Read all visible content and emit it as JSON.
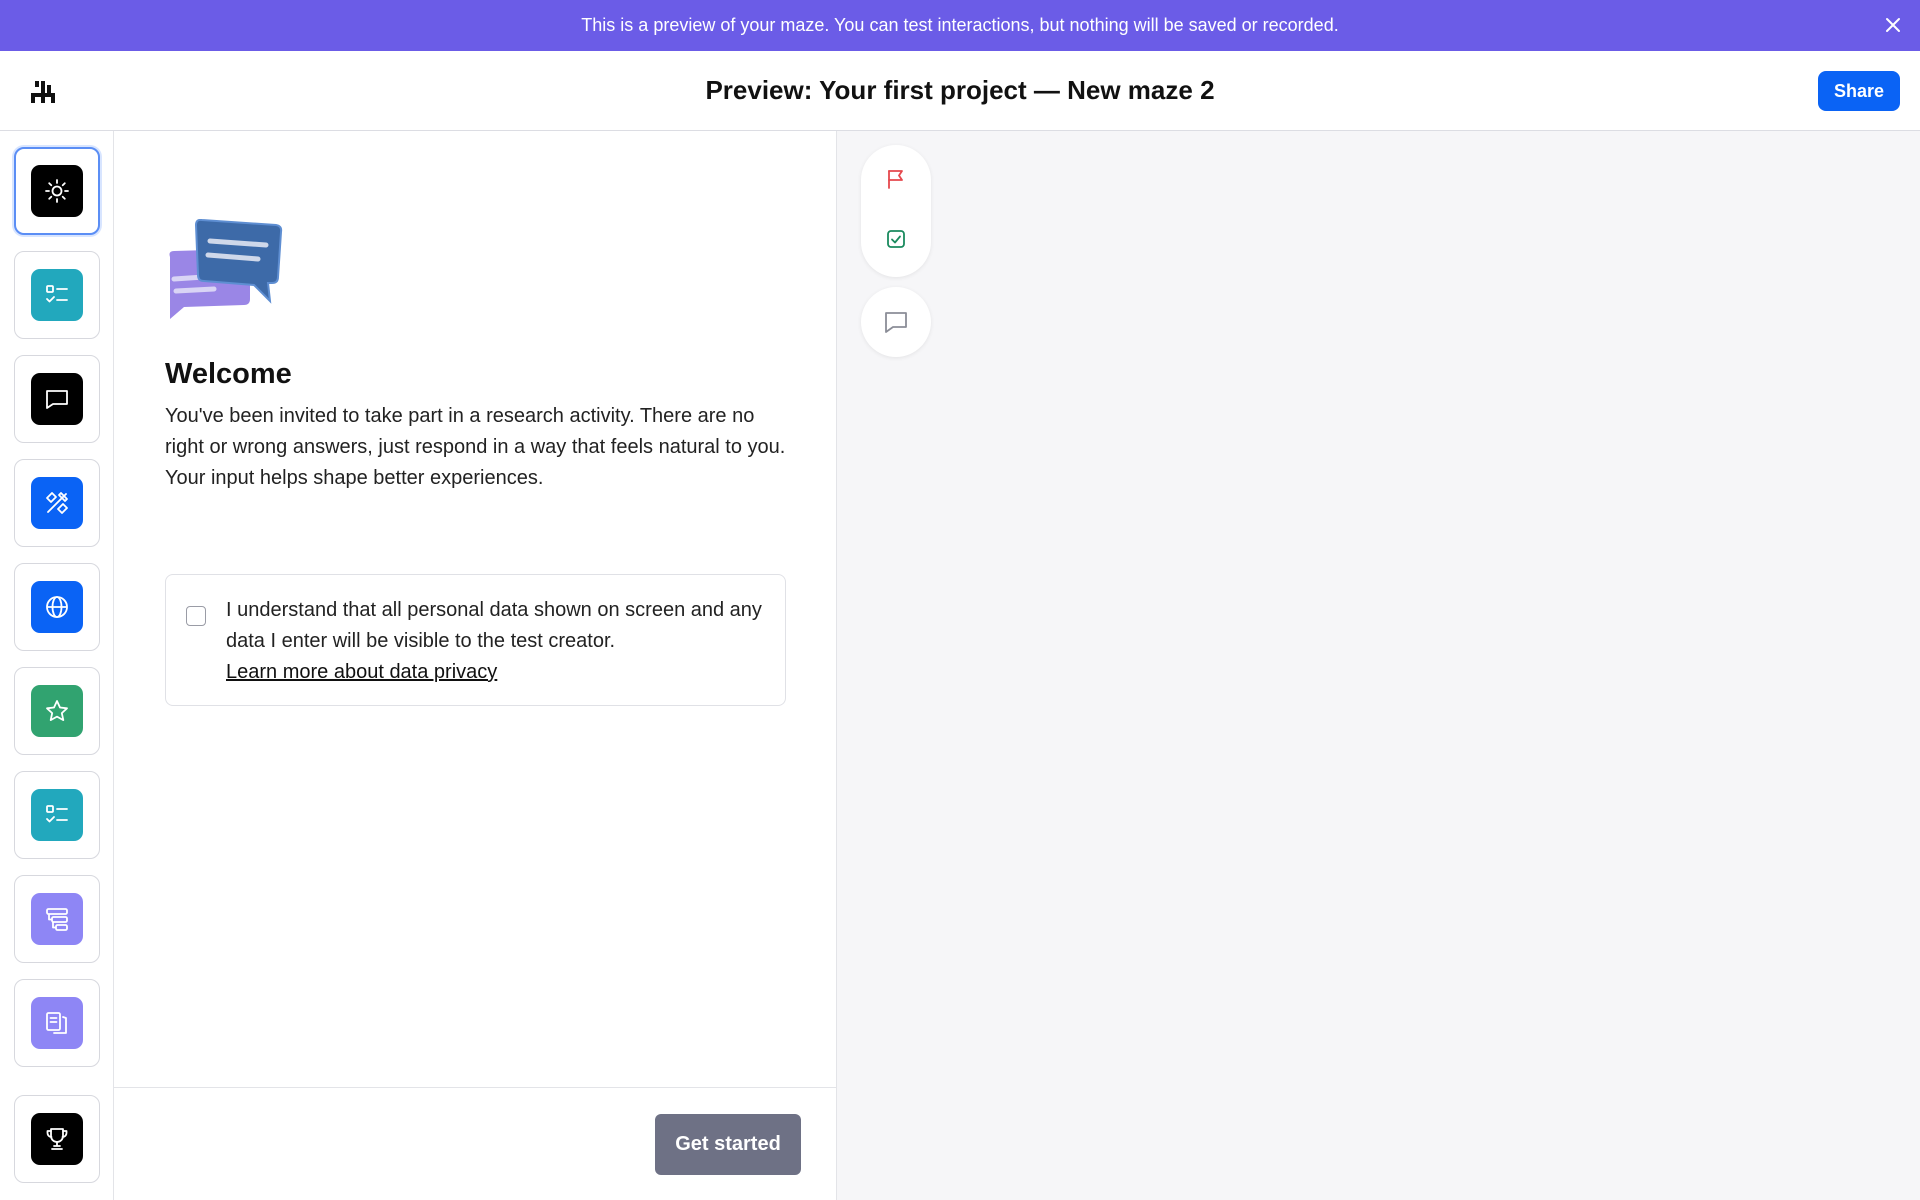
{
  "banner": {
    "message": "This is a preview of your maze. You can test interactions, but nothing will be saved or recorded.",
    "close_icon": "close-icon"
  },
  "header": {
    "logo_icon": "maze-logo-icon",
    "title": "Preview: Your first project — New maze 2",
    "share_label": "Share"
  },
  "sidebar": {
    "steps": [
      {
        "name": "welcome",
        "icon": "sun-icon",
        "color": "#000000",
        "active": true
      },
      {
        "name": "checklist",
        "icon": "checklist-icon",
        "color": "#22a8bd"
      },
      {
        "name": "message",
        "icon": "message-icon",
        "color": "#000000"
      },
      {
        "name": "design-test",
        "icon": "pencil-ruler-icon",
        "color": "#0a63f5"
      },
      {
        "name": "website-test",
        "icon": "globe-icon",
        "color": "#0a63f5"
      },
      {
        "name": "rating",
        "icon": "star-icon",
        "color": "#31a370"
      },
      {
        "name": "checklist-2",
        "icon": "checklist-icon",
        "color": "#22a8bd"
      },
      {
        "name": "tree-test",
        "icon": "tree-icon",
        "color": "#8e86f5"
      },
      {
        "name": "card-sort",
        "icon": "cards-icon",
        "color": "#8e86f5"
      },
      {
        "name": "thank-you",
        "icon": "trophy-icon",
        "color": "#000000"
      }
    ]
  },
  "content": {
    "illustration_icon": "chat-bubbles-illustration",
    "title": "Welcome",
    "body": "You've been invited to take part in a research activity. There are no right or wrong answers, just respond in a way that feels natural to you. Your input helps shape better experiences.",
    "consent": {
      "text": "I understand that all personal data shown on screen and any data I enter will be visible to the test creator.",
      "link": "Learn more about data privacy",
      "checked": false
    },
    "cta_label": "Get started"
  },
  "preview_tools": {
    "flag_icon": "flag-icon",
    "flag_color": "#e5484d",
    "check_icon": "check-square-icon",
    "check_color": "#1a8a5e",
    "comment_icon": "comment-icon"
  },
  "colors": {
    "banner": "#6b5ce7",
    "accent": "#0a63f5",
    "cta_disabled": "#6e7185"
  }
}
